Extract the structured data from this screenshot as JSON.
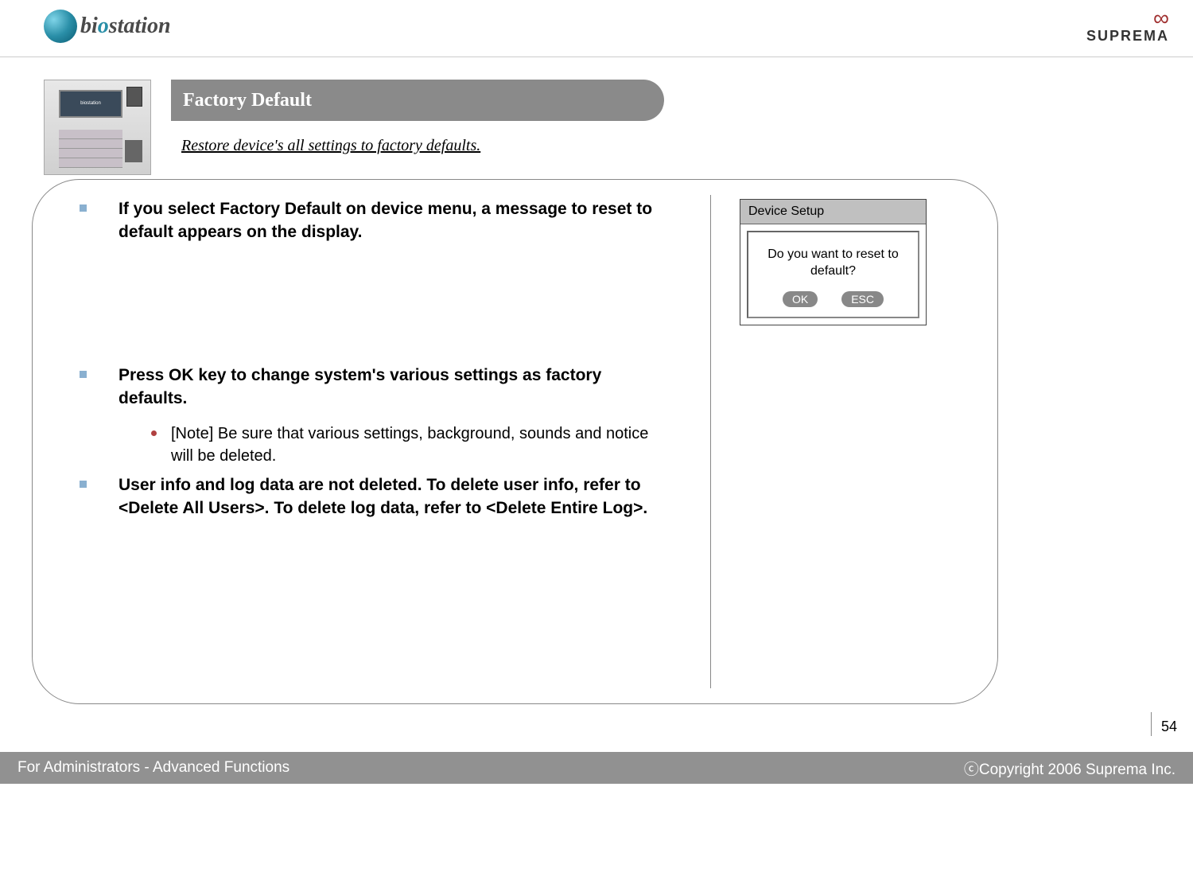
{
  "logo_left": {
    "bi": "bi",
    "o": "o",
    "station": "station"
  },
  "logo_right": "SUPREMA",
  "title": "Factory Default",
  "subtitle": "Restore device's all settings to factory defaults.",
  "bullets": {
    "b1": "If you select Factory Default on device menu, a message to reset to default appears on the display.",
    "b2": "Press OK key to change system's various settings as factory defaults.",
    "b2_sub": "[Note] Be sure that various settings, background, sounds and notice will be deleted.",
    "b3": "User info and log data are not deleted. To delete user info, refer to <Delete All Users>. To delete log data, refer to  <Delete Entire Log>."
  },
  "dialog": {
    "title": "Device Setup",
    "message": "Do you want to reset to default?",
    "ok": "OK",
    "esc": "ESC"
  },
  "page_num": "54",
  "footer_left": "For Administrators - Advanced Functions",
  "footer_right": "ⓒCopyright 2006 Suprema Inc."
}
